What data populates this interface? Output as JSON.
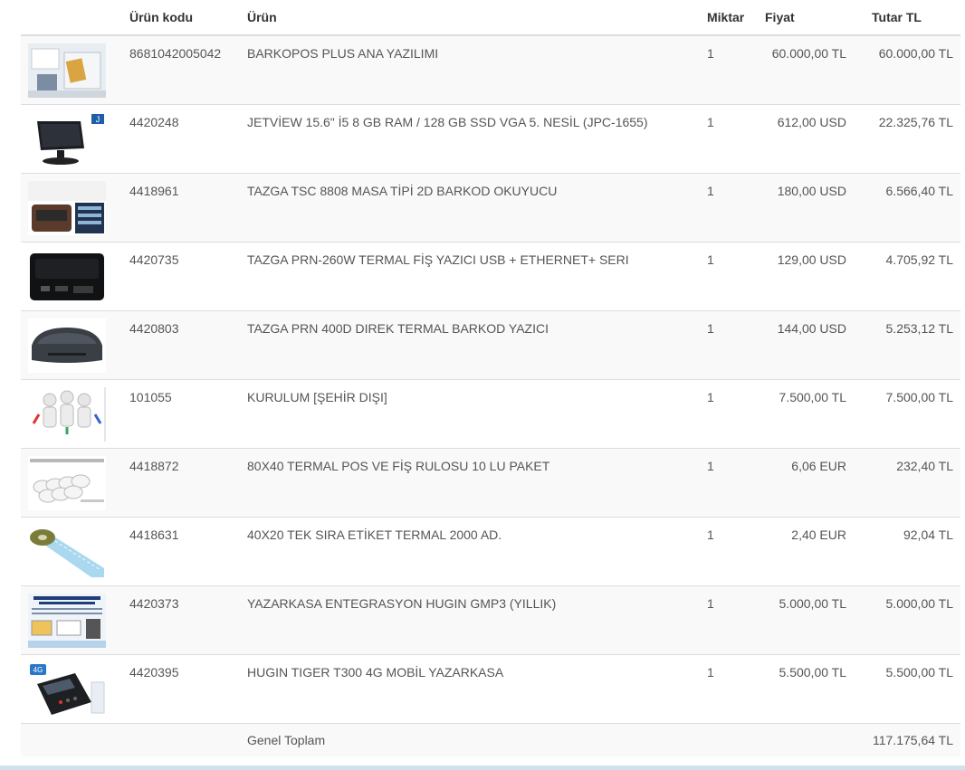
{
  "headers": {
    "image": "",
    "code": "Ürün kodu",
    "product": "Ürün",
    "quantity": "Miktar",
    "price": "Fiyat",
    "total": "Tutar TL"
  },
  "rows": [
    {
      "icon": "software-box-thumbnail-icon",
      "code": "8681042005042",
      "product": "BARKOPOS PLUS ANA YAZILIMI",
      "quantity": "1",
      "price": "60.000,00 TL",
      "total": "60.000,00 TL"
    },
    {
      "icon": "pos-touch-monitor-thumbnail-icon",
      "code": "4420248",
      "product": "JETVİEW 15.6\" İ5 8 GB RAM / 128 GB SSD VGA 5. NESİL (JPC-1655)",
      "quantity": "1",
      "price": "612,00 USD",
      "total": "22.325,76 TL"
    },
    {
      "icon": "barcode-scanner-thumbnail-icon",
      "code": "4418961",
      "product": "TAZGA TSC 8808 MASA TİPİ 2D BARKOD OKUYUCU",
      "quantity": "1",
      "price": "180,00 USD",
      "total": "6.566,40 TL"
    },
    {
      "icon": "thermal-printer-thumbnail-icon",
      "code": "4420735",
      "product": "TAZGA PRN-260W TERMAL FİŞ YAZICI USB + ETHERNET+ SERI",
      "quantity": "1",
      "price": "129,00 USD",
      "total": "4.705,92 TL"
    },
    {
      "icon": "label-printer-thumbnail-icon",
      "code": "4420803",
      "product": "TAZGA PRN 400D DIREK TERMAL BARKOD YAZICI",
      "quantity": "1",
      "price": "144,00 USD",
      "total": "5.253,12 TL"
    },
    {
      "icon": "installation-team-thumbnail-icon",
      "code": "101055",
      "product": "KURULUM [ŞEHİR DIŞI]",
      "quantity": "1",
      "price": "7.500,00 TL",
      "total": "7.500,00 TL"
    },
    {
      "icon": "paper-rolls-thumbnail-icon",
      "code": "4418872",
      "product": "80X40 TERMAL POS VE FİŞ RULOSU 10 LU PAKET",
      "quantity": "1",
      "price": "6,06 EUR",
      "total": "232,40 TL"
    },
    {
      "icon": "label-roll-thumbnail-icon",
      "code": "4418631",
      "product": "40X20 TEK SIRA ETİKET TERMAL 2000 AD.",
      "quantity": "1",
      "price": "2,40 EUR",
      "total": "92,04 TL"
    },
    {
      "icon": "cash-register-integration-thumbnail-icon",
      "code": "4420373",
      "product": "YAZARKASA ENTEGRASYON HUGIN GMP3 (YILLIK)",
      "quantity": "1",
      "price": "5.000,00 TL",
      "total": "5.000,00 TL"
    },
    {
      "icon": "mobile-pos-device-thumbnail-icon",
      "code": "4420395",
      "product": "HUGIN TIGER T300 4G MOBİL YAZARKASA",
      "quantity": "1",
      "price": "5.500,00 TL",
      "total": "5.500,00 TL"
    }
  ],
  "footer": {
    "label": "Genel Toplam",
    "total": "117.175,64 TL"
  }
}
